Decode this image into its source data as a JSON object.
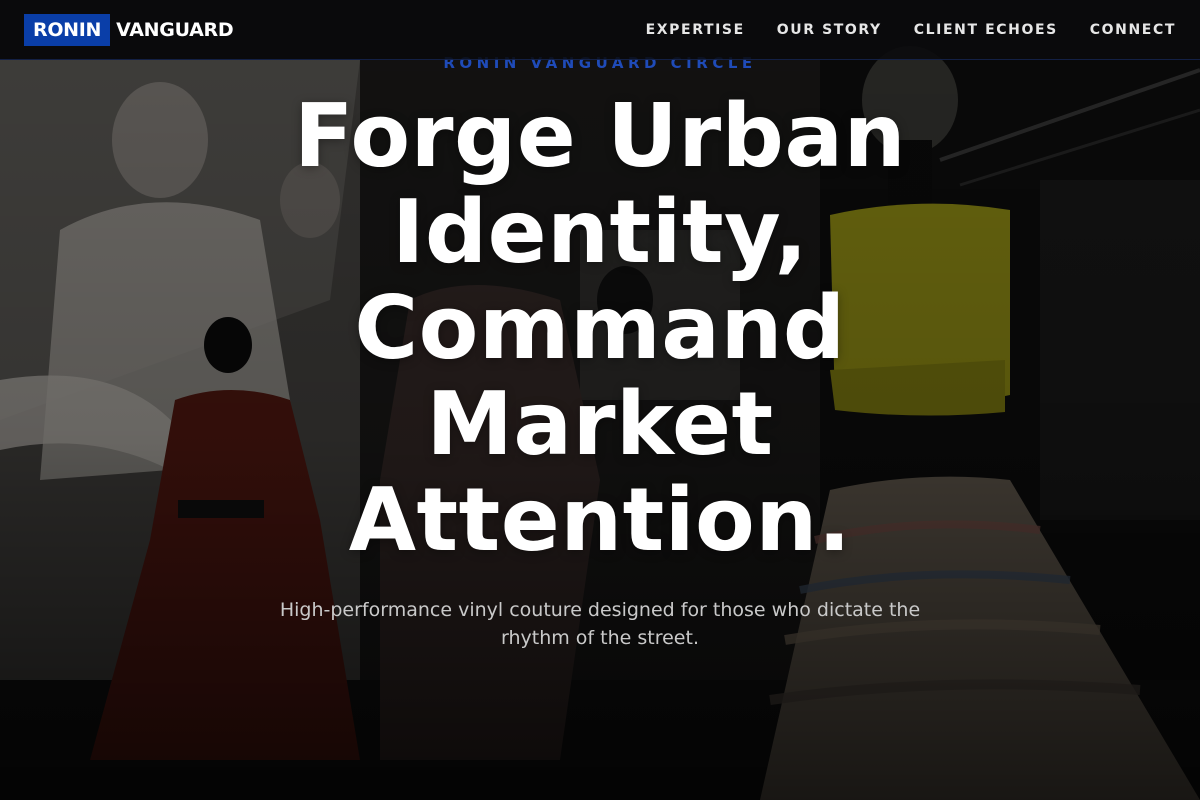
{
  "brand": {
    "logo_box": "RONIN",
    "logo_text": "VANGUARD",
    "accent_color": "#0a3ea8"
  },
  "nav": {
    "items": [
      {
        "label": "EXPERTISE"
      },
      {
        "label": "OUR STORY"
      },
      {
        "label": "CLIENT ECHOES"
      },
      {
        "label": "CONNECT"
      }
    ]
  },
  "hero": {
    "eyebrow": "RONIN VANGUARD CIRCLE",
    "headline": "Forge Urban Identity, Command Market Attention.",
    "subheadline": "High-performance vinyl couture designed for those who dictate the rhythm of the street."
  }
}
